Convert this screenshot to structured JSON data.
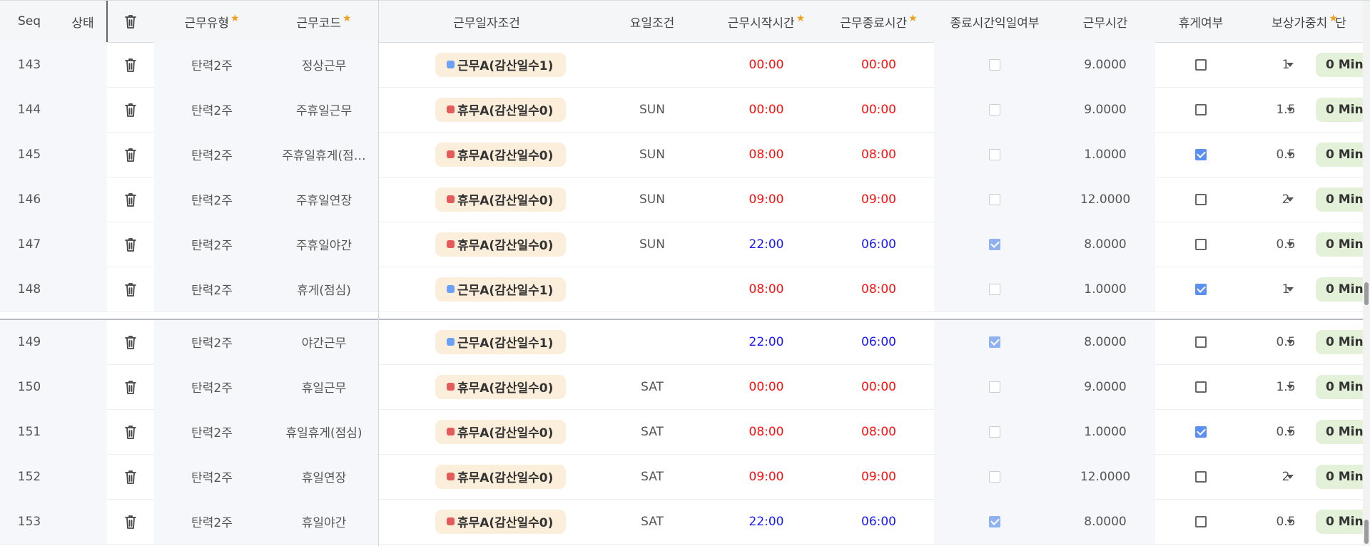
{
  "columns": [
    {
      "key": "seq",
      "label": "Seq",
      "required": false
    },
    {
      "key": "status",
      "label": "상태",
      "required": false
    },
    {
      "key": "del",
      "label": "",
      "required": false
    },
    {
      "key": "type",
      "label": "근무유형",
      "required": true
    },
    {
      "key": "code",
      "label": "근무코드",
      "required": true
    },
    {
      "key": "date",
      "label": "근무일자조건",
      "required": false
    },
    {
      "key": "day",
      "label": "요일조건",
      "required": false
    },
    {
      "key": "start",
      "label": "근무시작시간",
      "required": true
    },
    {
      "key": "end",
      "label": "근무종료시간",
      "required": true
    },
    {
      "key": "nextday",
      "label": "종료시간익일여부",
      "required": false
    },
    {
      "key": "hours",
      "label": "근무시간",
      "required": false
    },
    {
      "key": "rest",
      "label": "휴게여부",
      "required": false
    },
    {
      "key": "weight",
      "label": "보상가중치",
      "required": true
    },
    {
      "key": "unit",
      "label": "단",
      "required": false
    }
  ],
  "colors": {
    "work": "#6aa0f5",
    "off": "#e45b5b",
    "time_red": "#ff1212",
    "time_blue": "#1a1aff",
    "pill_bg": "#fbefdc",
    "min_pill_bg": "#e3f1d9"
  },
  "icons": {
    "delete": "trash-icon",
    "dropdown": "caret-down-icon"
  },
  "rows": [
    {
      "seq": "143",
      "type": "탄력2주",
      "code": "정상근무",
      "date_kind": "work",
      "date": "근무A(감산일수1)",
      "day": "",
      "start": "00:00",
      "end": "00:00",
      "time_color": "red",
      "nextday": false,
      "hours": "9.0000",
      "rest": false,
      "weight": "1",
      "unit": "0 Min"
    },
    {
      "seq": "144",
      "type": "탄력2주",
      "code": "주휴일근무",
      "date_kind": "off",
      "date": "휴무A(감산일수0)",
      "day": "SUN",
      "start": "00:00",
      "end": "00:00",
      "time_color": "red",
      "nextday": false,
      "hours": "9.0000",
      "rest": false,
      "weight": "1.5",
      "unit": "0 Min"
    },
    {
      "seq": "145",
      "type": "탄력2주",
      "code": "주휴일휴게(점…",
      "date_kind": "off",
      "date": "휴무A(감산일수0)",
      "day": "SUN",
      "start": "08:00",
      "end": "08:00",
      "time_color": "red",
      "nextday": false,
      "hours": "1.0000",
      "rest": true,
      "weight": "0.5",
      "unit": "0 Min"
    },
    {
      "seq": "146",
      "type": "탄력2주",
      "code": "주휴일연장",
      "date_kind": "off",
      "date": "휴무A(감산일수0)",
      "day": "SUN",
      "start": "09:00",
      "end": "09:00",
      "time_color": "red",
      "nextday": false,
      "hours": "12.0000",
      "rest": false,
      "weight": "2",
      "unit": "0 Min"
    },
    {
      "seq": "147",
      "type": "탄력2주",
      "code": "주휴일야간",
      "date_kind": "off",
      "date": "휴무A(감산일수0)",
      "day": "SUN",
      "start": "22:00",
      "end": "06:00",
      "time_color": "blue",
      "nextday": true,
      "hours": "8.0000",
      "rest": false,
      "weight": "0.5",
      "unit": "0 Min"
    },
    {
      "seq": "148",
      "type": "탄력2주",
      "code": "휴게(점심)",
      "date_kind": "work",
      "date": "근무A(감산일수1)",
      "day": "",
      "start": "08:00",
      "end": "08:00",
      "time_color": "red",
      "nextday": false,
      "hours": "1.0000",
      "rest": true,
      "weight": "1",
      "unit": "0 Min"
    },
    {
      "seq": "149",
      "type": "탄력2주",
      "code": "야간근무",
      "date_kind": "work",
      "date": "근무A(감산일수1)",
      "day": "",
      "start": "22:00",
      "end": "06:00",
      "time_color": "blue",
      "nextday": true,
      "hours": "8.0000",
      "rest": false,
      "weight": "0.5",
      "unit": "0 Min"
    },
    {
      "seq": "150",
      "type": "탄력2주",
      "code": "휴일근무",
      "date_kind": "off",
      "date": "휴무A(감산일수0)",
      "day": "SAT",
      "start": "00:00",
      "end": "00:00",
      "time_color": "red",
      "nextday": false,
      "hours": "9.0000",
      "rest": false,
      "weight": "1.5",
      "unit": "0 Min"
    },
    {
      "seq": "151",
      "type": "탄력2주",
      "code": "휴일휴게(점심)",
      "date_kind": "off",
      "date": "휴무A(감산일수0)",
      "day": "SAT",
      "start": "08:00",
      "end": "08:00",
      "time_color": "red",
      "nextday": false,
      "hours": "1.0000",
      "rest": true,
      "weight": "0.5",
      "unit": "0 Min"
    },
    {
      "seq": "152",
      "type": "탄력2주",
      "code": "휴일연장",
      "date_kind": "off",
      "date": "휴무A(감산일수0)",
      "day": "SAT",
      "start": "09:00",
      "end": "09:00",
      "time_color": "red",
      "nextday": false,
      "hours": "12.0000",
      "rest": false,
      "weight": "2",
      "unit": "0 Min"
    },
    {
      "seq": "153",
      "type": "탄력2주",
      "code": "휴일야간",
      "date_kind": "off",
      "date": "휴무A(감산일수0)",
      "day": "SAT",
      "start": "22:00",
      "end": "06:00",
      "time_color": "blue",
      "nextday": true,
      "hours": "8.0000",
      "rest": false,
      "weight": "0.5",
      "unit": "0 Min"
    }
  ]
}
